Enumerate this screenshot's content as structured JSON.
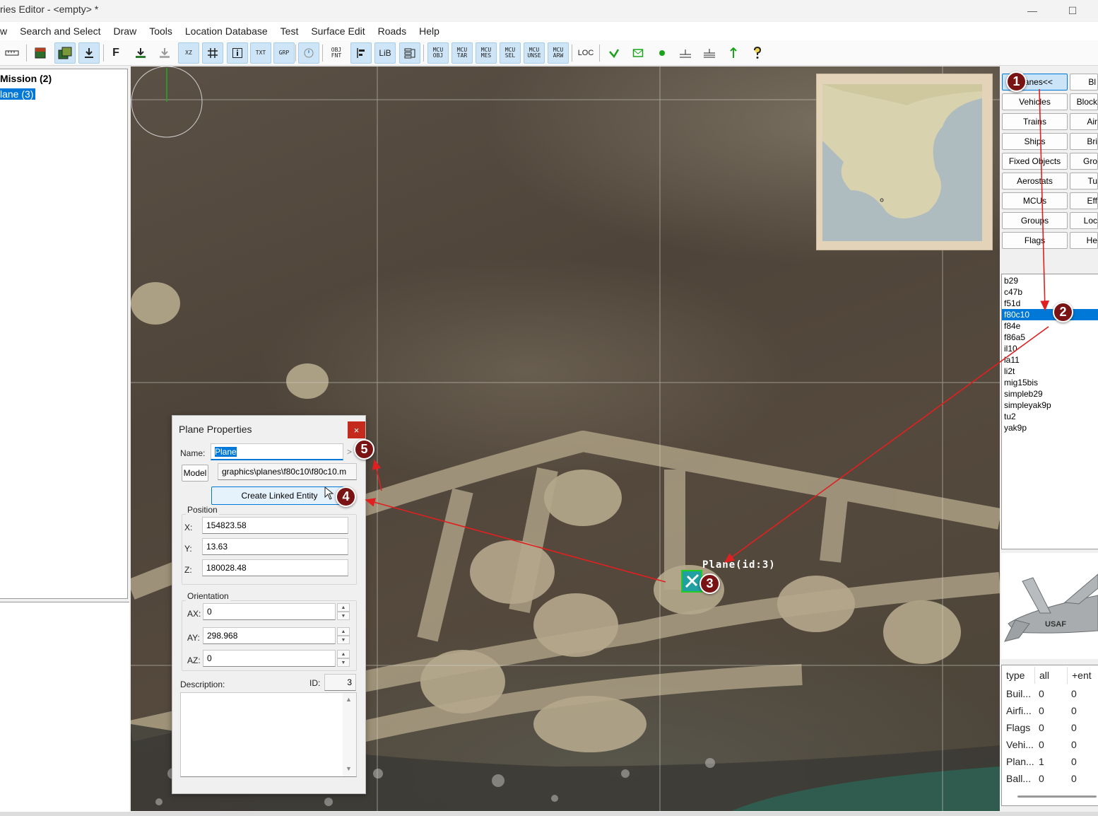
{
  "window": {
    "title": "ries Editor - <empty> *",
    "minimize_glyph": "—",
    "maximize_glyph": "☐"
  },
  "menu": [
    "w",
    "Search and Select",
    "Draw",
    "Tools",
    "Location Database",
    "Test",
    "Surface Edit",
    "Roads",
    "Help"
  ],
  "toolbar": {
    "text_buttons": {
      "f": "F",
      "xz": "XZ",
      "txt": "TXT",
      "grp": "GRP",
      "objfnt": "OBJ FNT",
      "lib": "LiB",
      "mcu_obj": "MCU OBJ",
      "mcu_tar": "MCU TAR",
      "mcu_mes": "MCU MES",
      "mcu_sel": "MCU SEL",
      "mcu_unse": "MCU UNSE",
      "mcu_arw": "MCU ARW",
      "loc": "LOC"
    }
  },
  "tree": {
    "root": "Mission (2)",
    "child": "lane (3)"
  },
  "map": {
    "object_label": "Plane(id:3)"
  },
  "categories": {
    "left": [
      "Planes<<",
      "Vehicles",
      "Trains",
      "Ships",
      "Fixed Objects",
      "Aerostats",
      "MCUs",
      "Groups",
      "Flags"
    ],
    "right": [
      "Bl",
      "Block",
      "Air",
      "Bri",
      "Gro",
      "Tu",
      "Eff",
      "Loc",
      "He"
    ],
    "active": "Planes<<"
  },
  "plane_list": {
    "items": [
      "b29",
      "c47b",
      "f51d",
      "f80c10",
      "f84e",
      "f86a5",
      "il10",
      "la11",
      "li2t",
      "mig15bis",
      "simpleb29",
      "simpleyak9p",
      "tu2",
      "yak9p"
    ],
    "selected": "f80c10"
  },
  "preview": {
    "tail_text": "USAF"
  },
  "stats": {
    "headers": [
      "type",
      "all",
      "+ent"
    ],
    "rows": [
      {
        "type": "Buil...",
        "all": "0",
        "ent": "0"
      },
      {
        "type": "Airfi...",
        "all": "0",
        "ent": "0"
      },
      {
        "type": "Flags",
        "all": "0",
        "ent": "0"
      },
      {
        "type": "Vehi...",
        "all": "0",
        "ent": "0"
      },
      {
        "type": "Plan...",
        "all": "1",
        "ent": "0"
      },
      {
        "type": "Ball...",
        "all": "0",
        "ent": "0"
      }
    ]
  },
  "props": {
    "title": "Plane Properties",
    "close_glyph": "×",
    "name_label": "Name:",
    "name_value": "Plane",
    "name_more": ">",
    "model_button": "Model",
    "model_value": "graphics\\planes\\f80c10\\f80c10.m",
    "linked_button": "Create Linked Entity",
    "position_label": "Position",
    "x_label": "X:",
    "x_value": "154823.58",
    "y_label": "Y:",
    "y_value": "13.63",
    "z_label": "Z:",
    "z_value": "180028.48",
    "orientation_label": "Orientation",
    "ax_label": "AX:",
    "ax_value": "0",
    "ay_label": "AY:",
    "ay_value": "298.968",
    "az_label": "AZ:",
    "az_value": "0",
    "description_label": "Description:",
    "id_label": "ID:",
    "id_value": "3",
    "spin_up": "▲",
    "spin_down": "▼"
  },
  "markers": [
    "1",
    "2",
    "3",
    "4",
    "5"
  ],
  "colors": {
    "selection": "#0078d7",
    "marker": "#7a1414",
    "arrow": "#e02020",
    "close": "#c42b1c"
  }
}
